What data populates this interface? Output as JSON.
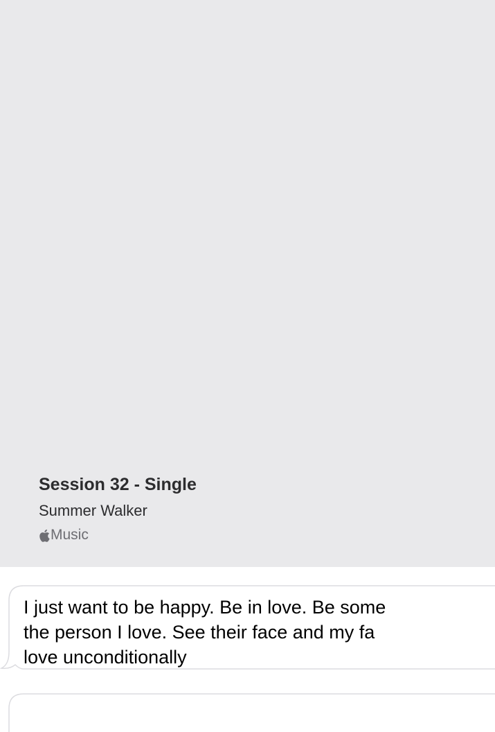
{
  "music_card": {
    "title": "Session 32 - Single",
    "artist": "Summer Walker",
    "source": "Music",
    "source_icon": "apple-logo-icon",
    "background_color": "#e9e9eb"
  },
  "messages": [
    {
      "text": "I just want to be happy. Be in love. Be some\nthe person I love. See their face and my fa\nlove unconditionally"
    },
    {
      "text": ""
    }
  ]
}
